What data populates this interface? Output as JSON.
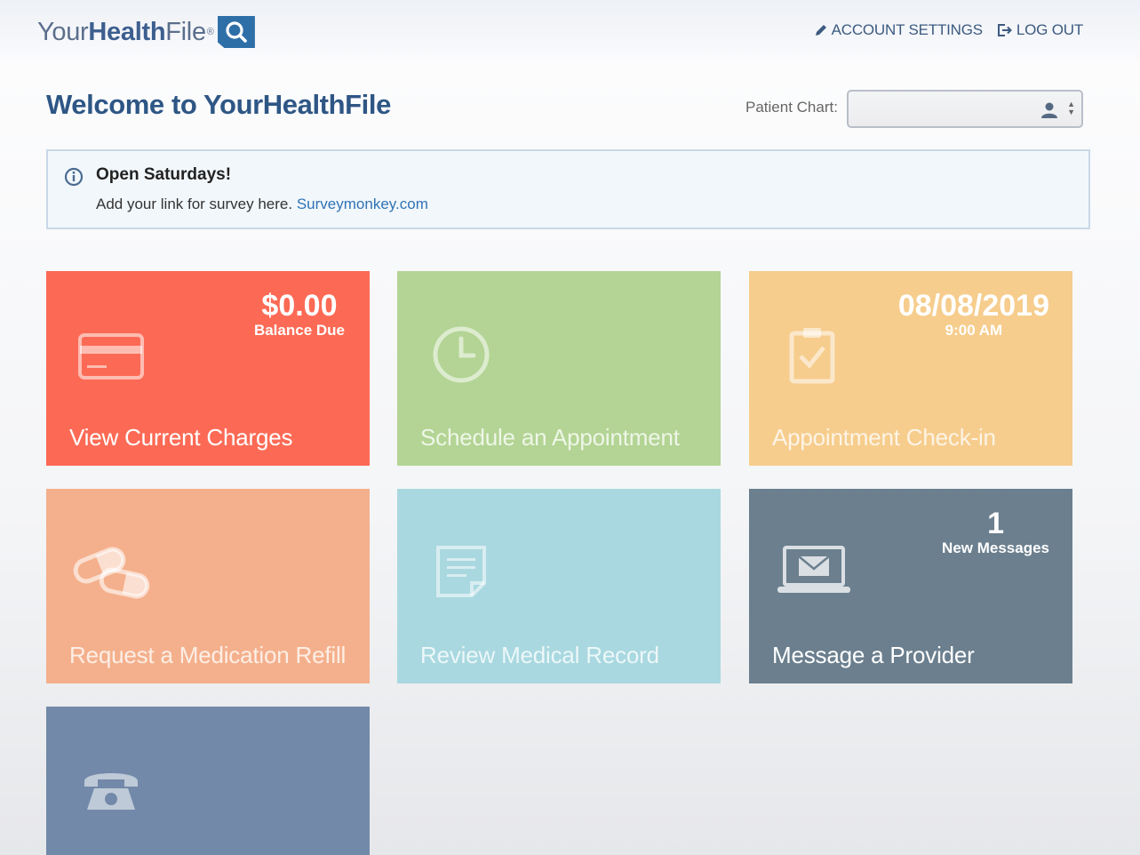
{
  "header": {
    "logo": {
      "text_light": "Your",
      "text_bold": "Health",
      "text_end": "File",
      "reg_mark": "®"
    },
    "links": {
      "account_settings": "ACCOUNT SETTINGS",
      "log_out": "LOG OUT"
    }
  },
  "page": {
    "title": "Welcome to YourHealthFile",
    "patient_chart_label": "Patient Chart:",
    "patient_chart_value": ""
  },
  "notice": {
    "title": "Open Saturdays!",
    "body": "Add your link for survey here.",
    "link": "Surveymonkey.com"
  },
  "tiles": {
    "charges": {
      "label": "View Current Charges",
      "stat_value": "$0.00",
      "stat_sub": "Balance Due"
    },
    "schedule": {
      "label": "Schedule an Appointment"
    },
    "checkin": {
      "label": "Appointment Check-in",
      "stat_value": "08/08/2019",
      "stat_sub": "9:00 AM"
    },
    "refill": {
      "label": "Request a Medication Refill"
    },
    "record": {
      "label": "Review Medical Record"
    },
    "message": {
      "label": "Message a Provider",
      "stat_value": "1",
      "stat_sub": "New Messages"
    },
    "call": {
      "label": ""
    }
  },
  "colors": {
    "brand_blue": "#2f6fa8",
    "title_blue": "#2e5685",
    "charges": "#fc6a55",
    "schedule": "#b3d494",
    "checkin": "#f6cd8d",
    "refill": "#f4b08c",
    "record": "#a9d8e0",
    "message": "#6b7f8e",
    "call": "#7289a9"
  },
  "icons": {
    "account_settings": "pencil-icon",
    "log_out": "logout-icon",
    "patient_chart": "user-icon",
    "notice": "info-icon",
    "charges": "credit-card-icon",
    "schedule": "clock-icon",
    "checkin": "clipboard-check-icon",
    "refill": "pills-icon",
    "record": "document-icon",
    "message": "laptop-mail-icon",
    "call": "telephone-icon"
  }
}
